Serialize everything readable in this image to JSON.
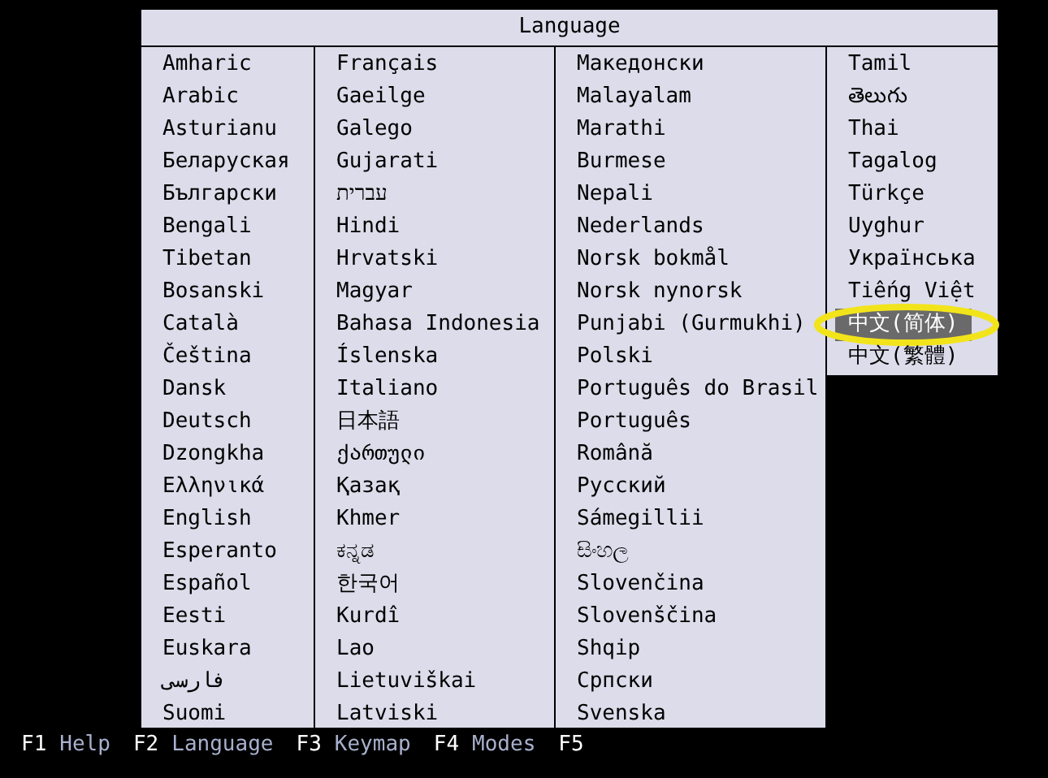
{
  "dialog": {
    "title": "Language",
    "columns": [
      [
        {
          "label": "Amharic",
          "selected": false
        },
        {
          "label": "Arabic",
          "selected": false
        },
        {
          "label": "Asturianu",
          "selected": false
        },
        {
          "label": "Беларуская",
          "selected": false
        },
        {
          "label": "Български",
          "selected": false
        },
        {
          "label": "Bengali",
          "selected": false
        },
        {
          "label": "Tibetan",
          "selected": false
        },
        {
          "label": "Bosanski",
          "selected": false
        },
        {
          "label": "Català",
          "selected": false
        },
        {
          "label": "Čeština",
          "selected": false
        },
        {
          "label": "Dansk",
          "selected": false
        },
        {
          "label": "Deutsch",
          "selected": false
        },
        {
          "label": "Dzongkha",
          "selected": false
        },
        {
          "label": "Ελληνικά",
          "selected": false
        },
        {
          "label": "English",
          "selected": false
        },
        {
          "label": "Esperanto",
          "selected": false
        },
        {
          "label": "Español",
          "selected": false
        },
        {
          "label": "Eesti",
          "selected": false
        },
        {
          "label": "Euskara",
          "selected": false
        },
        {
          "label": "فارسی",
          "selected": false
        },
        {
          "label": "Suomi",
          "selected": false
        }
      ],
      [
        {
          "label": "Français",
          "selected": false
        },
        {
          "label": "Gaeilge",
          "selected": false
        },
        {
          "label": "Galego",
          "selected": false
        },
        {
          "label": "Gujarati",
          "selected": false
        },
        {
          "label": "עברית",
          "selected": false
        },
        {
          "label": "Hindi",
          "selected": false
        },
        {
          "label": "Hrvatski",
          "selected": false
        },
        {
          "label": "Magyar",
          "selected": false
        },
        {
          "label": "Bahasa Indonesia",
          "selected": false
        },
        {
          "label": "Íslenska",
          "selected": false
        },
        {
          "label": "Italiano",
          "selected": false
        },
        {
          "label": "日本語",
          "selected": false
        },
        {
          "label": "ქართული",
          "selected": false
        },
        {
          "label": "Қазақ",
          "selected": false
        },
        {
          "label": "Khmer",
          "selected": false
        },
        {
          "label": "ಕನ್ನಡ",
          "selected": false
        },
        {
          "label": "한국어",
          "selected": false
        },
        {
          "label": "Kurdî",
          "selected": false
        },
        {
          "label": "Lao",
          "selected": false
        },
        {
          "label": "Lietuviškai",
          "selected": false
        },
        {
          "label": "Latviski",
          "selected": false
        }
      ],
      [
        {
          "label": "Македонски",
          "selected": false
        },
        {
          "label": "Malayalam",
          "selected": false
        },
        {
          "label": "Marathi",
          "selected": false
        },
        {
          "label": "Burmese",
          "selected": false
        },
        {
          "label": "Nepali",
          "selected": false
        },
        {
          "label": "Nederlands",
          "selected": false
        },
        {
          "label": "Norsk bokmål",
          "selected": false
        },
        {
          "label": "Norsk nynorsk",
          "selected": false
        },
        {
          "label": "Punjabi (Gurmukhi)",
          "selected": false
        },
        {
          "label": "Polski",
          "selected": false
        },
        {
          "label": "Português do Brasil",
          "selected": false
        },
        {
          "label": "Português",
          "selected": false
        },
        {
          "label": "Română",
          "selected": false
        },
        {
          "label": "Русский",
          "selected": false
        },
        {
          "label": "Sámegillii",
          "selected": false
        },
        {
          "label": "සිංහල",
          "selected": false
        },
        {
          "label": "Slovenčina",
          "selected": false
        },
        {
          "label": "Slovenščina",
          "selected": false
        },
        {
          "label": "Shqip",
          "selected": false
        },
        {
          "label": "Српски",
          "selected": false
        },
        {
          "label": "Svenska",
          "selected": false
        }
      ],
      [
        {
          "label": "Tamil",
          "selected": false
        },
        {
          "label": "తెలుగు",
          "selected": false
        },
        {
          "label": "Thai",
          "selected": false
        },
        {
          "label": "Tagalog",
          "selected": false
        },
        {
          "label": "Türkçe",
          "selected": false
        },
        {
          "label": "Uyghur",
          "selected": false
        },
        {
          "label": "Українська",
          "selected": false
        },
        {
          "label": "Tiếng Việt",
          "selected": false
        },
        {
          "label": "中文(简体)",
          "selected": true,
          "circled": true
        },
        {
          "label": "中文(繁體)",
          "selected": false
        }
      ]
    ]
  },
  "function_keys": [
    {
      "key": "F1",
      "label": "Help"
    },
    {
      "key": "F2",
      "label": "Language"
    },
    {
      "key": "F3",
      "label": "Keymap"
    },
    {
      "key": "F4",
      "label": "Modes"
    },
    {
      "key": "F5"
    }
  ]
}
